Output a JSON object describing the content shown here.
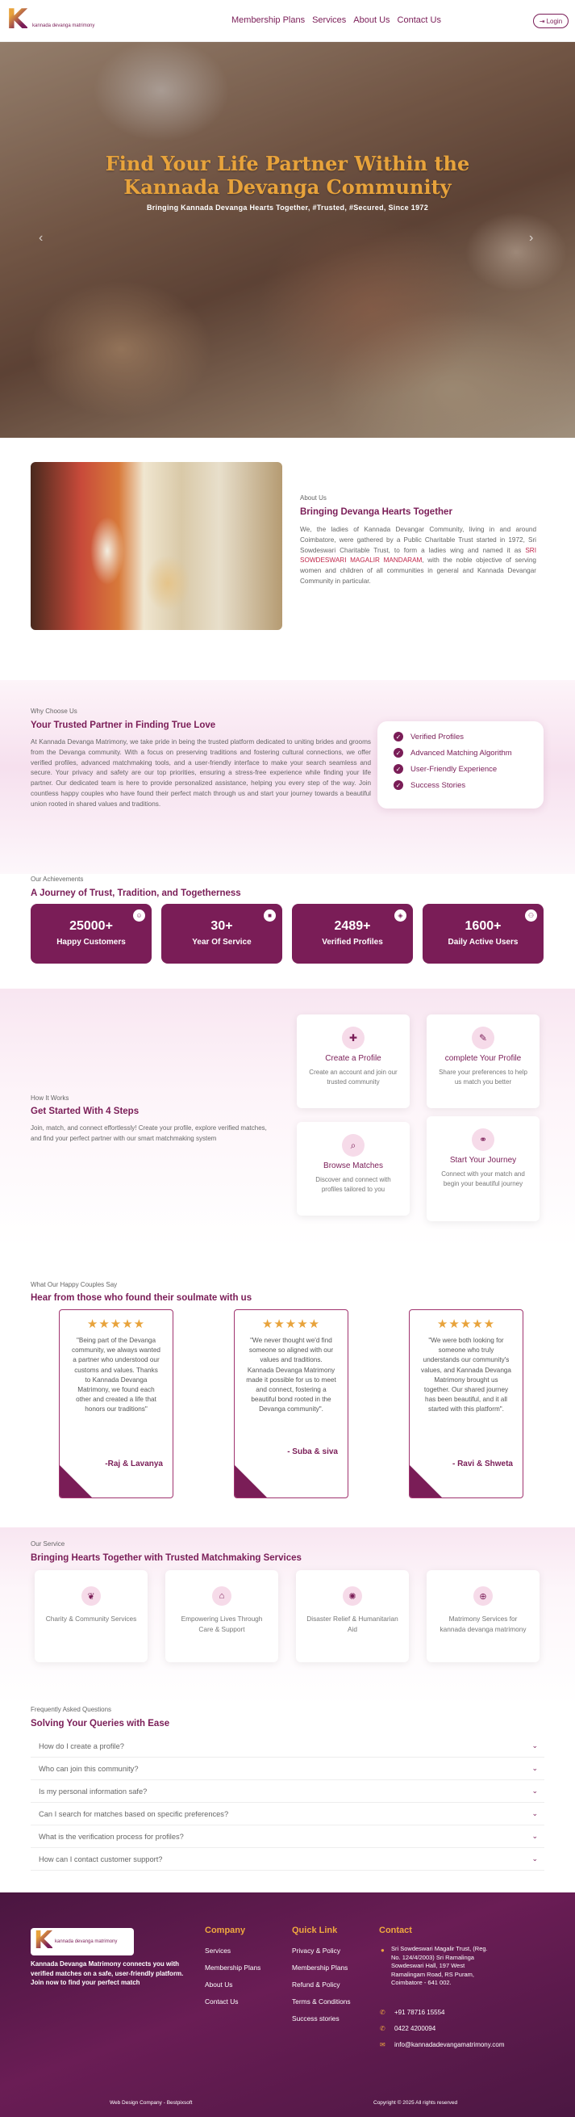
{
  "header": {
    "brand_letter": "K",
    "brand_text": "kannada devanga matrimony",
    "nav": [
      "Membership Plans",
      "Services",
      "About Us",
      "Contact Us"
    ],
    "login_label": "Login"
  },
  "hero": {
    "title_line1": "Find Your Life Partner Within the",
    "title_line2": "Kannada Devanga Community",
    "subtitle": "Bringing Kannada Devanga Hearts Together, #Trusted, #Secured, Since 1972",
    "prev": "‹",
    "next": "›"
  },
  "about": {
    "label": "About Us",
    "title": "Bringing Devanga Hearts Together",
    "text_pre": "We, the ladies of Kannada Devangar Community, living in and around Coimbatore, were gathered by a Public Charitable Trust started in 1972, Sri Sowdeswari Charitable Trust, to form a ladies wing and named it as ",
    "text_hl": "SRI SOWDESWARI MAGALIR MANDARAM",
    "text_post": ", with the noble objective of serving women and children of all communities in general and Kannada Devangar Community in particular."
  },
  "why": {
    "label": "Why Choose Us",
    "title": "Your Trusted Partner in Finding True Love",
    "text": "At Kannada Devanga Matrimony, we take pride in being the trusted platform dedicated to uniting brides and grooms from the Devanga community. With a focus on preserving traditions and fostering cultural connections, we offer verified profiles, advanced matchmaking tools, and a user-friendly interface to make your search seamless and secure. Your privacy and safety are our top priorities, ensuring a stress-free experience while finding your life partner. Our dedicated team is here to provide personalized assistance, helping you every step of the way. Join countless happy couples who have found their perfect match through us and start your journey towards a beautiful union rooted in shared values and traditions.",
    "features": [
      "Verified Profiles",
      "Advanced Matching Algorithm",
      "User-Friendly Experience",
      "Success Stories"
    ]
  },
  "achievements": {
    "label": "Our Achievements",
    "title": "A Journey of Trust, Tradition, and Togetherness",
    "stats": [
      {
        "value": "25000+",
        "label": "Happy Customers"
      },
      {
        "value": "30+",
        "label": "Year Of Service"
      },
      {
        "value": "2489+",
        "label": "Verified Profiles"
      },
      {
        "value": "1600+",
        "label": "Daily Active Users"
      }
    ]
  },
  "how": {
    "label": "How It Works",
    "title": "Get Started With 4 Steps",
    "text": "Join, match, and connect effortlessly! Create your profile, explore verified matches, and find your perfect partner with our smart matchmaking system",
    "steps": [
      {
        "title": "Create a Profile",
        "desc": "Create an account and join our trusted community"
      },
      {
        "title": "complete Your Profile",
        "desc": "Share your preferences to help us match you better"
      },
      {
        "title": "Browse Matches",
        "desc": "Discover and connect with profiles tailored to you"
      },
      {
        "title": "Start Your Journey",
        "desc": "Connect with your match and begin your beautiful journey"
      }
    ]
  },
  "testimonials": {
    "label": "What Our Happy Couples Say",
    "title": "Hear from those who found their soulmate with us",
    "stars": "★★★★★",
    "items": [
      {
        "quote": "\"Being part of the Devanga community, we always wanted a partner who understood our customs and values. Thanks to Kannada Devanga Matrimony, we found each other and created a life that honors our traditions\"",
        "name": "-Raj & Lavanya"
      },
      {
        "quote": "\"We never thought we'd find someone so aligned with our values and traditions. Kannada Devanga Matrimony made it possible for us to meet and connect, fostering a beautiful bond rooted in the Devanga community\".",
        "name": "- Suba & siva"
      },
      {
        "quote": "\"We were both looking for someone who truly understands our community's values, and Kannada Devanga Matrimony brought us together. Our shared journey has been beautiful, and it all started with this platform\".",
        "name": "- Ravi & Shweta"
      }
    ]
  },
  "services": {
    "label": "Our Service",
    "title": "Bringing Hearts Together with Trusted Matchmaking Services",
    "items": [
      "Charity & Community Services",
      "Empowering Lives Through Care & Support",
      "Disaster Relief & Humanitarian Aid",
      "Matrimony Services for kannada devanga matrimony"
    ]
  },
  "faq": {
    "label": "Frequently Asked Questions",
    "title": "Solving Your Queries with Ease",
    "items": [
      "How do I create a profile?",
      "Who can join this community?",
      "Is my personal information safe?",
      "Can I search for matches based on specific preferences?",
      "What is the verification process for profiles?",
      "How can I contact customer support?"
    ],
    "chevron": "⌄"
  },
  "footer": {
    "tagline": "Kannada Devanga Matrimony connects you with verified matches on a safe, user-friendly platform. Join now to find your perfect match",
    "company_title": "Company",
    "company_links": [
      "Services",
      "Membership Plans",
      "About Us",
      "Contact Us"
    ],
    "quick_title": "Quick Link",
    "quick_links": [
      "Privacy & Policy",
      "Membership Plans",
      "Refund & Policy",
      "Terms & Conditions",
      "Success stories"
    ],
    "contact_title": "Contact",
    "address": "Sri Sowdeswari Magalir Trust, (Reg. No. 124/4/2003) Sri Ramalinga Sowdeswari Hall, 197 West Ramalingam Road, RS Puram, Coimbatore - 641 002.",
    "phone1": "+91 78716 15554",
    "phone2": "0422 4200094",
    "email": "info@kannadadevangamatrimony.com",
    "credit": "Web Design Company - Bestpixsoft",
    "copyright": "Copyright © 2025 All rights reserved"
  },
  "colors": {
    "brand": "#7a1d57",
    "accent": "#e8a33b"
  }
}
